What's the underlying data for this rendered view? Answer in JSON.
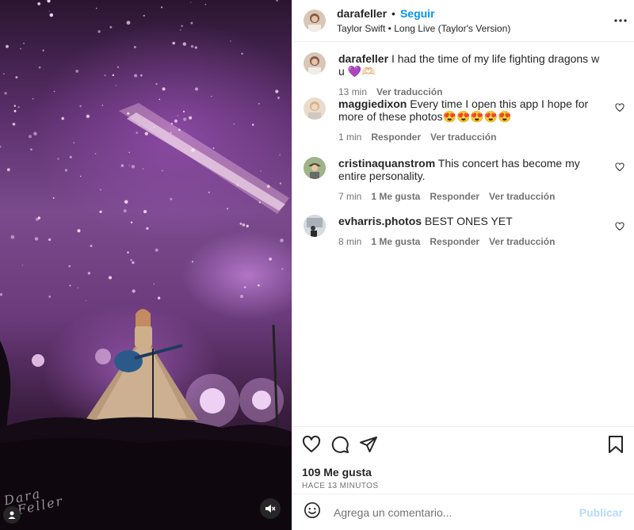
{
  "post": {
    "username": "darafeller",
    "separator": "•",
    "follow_label": "Seguir",
    "audio": "Taylor Swift • Long Live (Taylor's Version)",
    "more_icon": "more-horizontal-icon",
    "signature_line1": "Dara",
    "signature_line2": "Feller"
  },
  "comments": [
    {
      "user": "darafeller",
      "text": "I had the time of my life fighting dragons w u 💜🫶🏻",
      "time": "13 min",
      "likes": "",
      "reply": "",
      "translate": "Ver traducción"
    },
    {
      "user": "maggiedixon",
      "text": "Every time I open this app I hope for more of these photos😍😍😍😍😍",
      "time": "1 min",
      "likes": "",
      "reply": "Responder",
      "translate": "Ver traducción"
    },
    {
      "user": "cristinaquanstrom",
      "text": "This concert has become my entire personality.",
      "time": "7 min",
      "likes": "1 Me gusta",
      "reply": "Responder",
      "translate": "Ver traducción"
    },
    {
      "user": "evharris.photos",
      "text": "BEST ONES YET",
      "time": "8 min",
      "likes": "1 Me gusta",
      "reply": "Responder",
      "translate": "Ver traducción"
    }
  ],
  "actions": {
    "likes": "109 Me gusta",
    "timestamp": "HACE 13 MINUTOS"
  },
  "composer": {
    "placeholder": "Agrega un comentario...",
    "publish_label": "Publicar"
  },
  "colors": {
    "accent": "#0095f6",
    "publish_disabled": "#b3dbff",
    "muted_text": "#737373"
  }
}
